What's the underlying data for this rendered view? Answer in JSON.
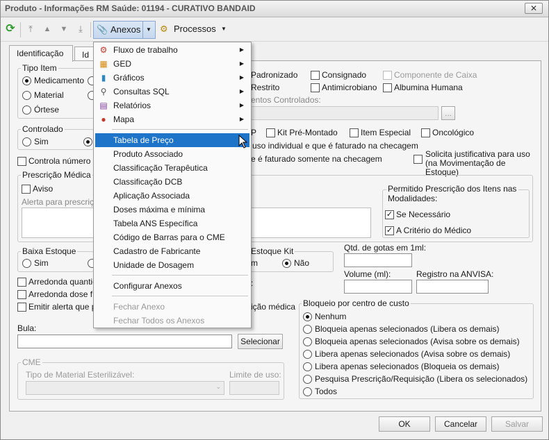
{
  "window": {
    "title": "Produto - Informações RM Saúde: 01194 - CURATIVO BANDAID",
    "close_label": "✕"
  },
  "toolbar": {
    "anexos_label": "Anexos",
    "processos_label": "Processos",
    "dropdown_glyph": "▼"
  },
  "tabs": [
    {
      "label": "Identificação"
    },
    {
      "label": "Id"
    }
  ],
  "tipo_item": {
    "label": "Tipo Item",
    "options": [
      "Medicamento",
      "Material",
      "Órtese"
    ],
    "selected": "Medicamento",
    "checks": [
      {
        "label": "Padronizado",
        "checked": false
      },
      {
        "label": "Consignado",
        "checked": false
      },
      {
        "label": "Componente de Caixa",
        "checked": false,
        "disabled": true
      },
      {
        "label": "Restrito",
        "checked": false
      },
      {
        "label": "Antimicrobiano",
        "checked": false
      },
      {
        "label": "Albumina Humana",
        "checked": false
      }
    ],
    "controlled_label": "entos Controlados:",
    "browse_label": "..."
  },
  "controlado": {
    "label": "Controlado",
    "option_sim": "Sim",
    "checks": [
      {
        "label": "P",
        "checked": false
      },
      {
        "label": "Kit Pré-Montado",
        "checked": false
      },
      {
        "label": "Item Especial",
        "checked": false
      },
      {
        "label": "Oncológico",
        "checked": false
      }
    ]
  },
  "fragments": {
    "uso_individual": "uso individual e que é faturado na checagem",
    "faturado_checagem": "e é faturado somente na checagem",
    "controla_numero": "Controla número d",
    "solicita_justificativa": "Solicita justificativa para uso (na Movimentação de Estoque)"
  },
  "prescricao": {
    "label": "Prescrição Médica",
    "aviso_label": "Aviso",
    "alerta_label": "Alerta para prescriçã",
    "permitido_label": "Permitido Prescrição dos Itens nas Modalidades:",
    "modalidades": [
      {
        "label": "Se Necessário",
        "checked": true
      },
      {
        "label": "A Critério do Médico",
        "checked": true
      }
    ]
  },
  "baixa_estoque": {
    "label": "Baixa Estoque",
    "option_sim": "Sim"
  },
  "estoque_kit": {
    "label": "Estoque Kit",
    "option_m": "m",
    "option_nao": "Não"
  },
  "gotas": {
    "label": "Qtd. de gotas em 1ml:",
    "value": ""
  },
  "volume": {
    "label": "Volume (ml):",
    "value": ""
  },
  "anvisa": {
    "label": "Registro na ANVISA:",
    "value": ""
  },
  "arredonda": [
    "Arredonda quantic",
    "Arredonda dose fr",
    "Emitir alerta que p"
  ],
  "alerta_medica_fragment": "ição médica",
  "colon_fragment": ":",
  "bloqueio": {
    "label": "Bloqueio por centro de custo",
    "options": [
      "Nenhum",
      "Bloqueia apenas selecionados (Libera os demais)",
      "Bloqueia apenas selecionados (Avisa sobre os demais)",
      "Libera apenas selecionados (Avisa sobre os demais)",
      "Libera apenas selecionados (Bloqueia os demais)",
      "Pesquisa Prescrição/Requisição (Libera os selecionados)",
      "Todos"
    ],
    "selected": "Nenhum"
  },
  "bula": {
    "label": "Bula:",
    "value": "",
    "button_label": "Selecionar"
  },
  "cme": {
    "label": "CME",
    "tipo_label": "Tipo de Material Esterilizável:",
    "limite_label": "Limite de uso:"
  },
  "footer": {
    "ok_label": "OK",
    "cancel_label": "Cancelar",
    "save_label": "Salvar"
  },
  "anexos_menu": {
    "items": [
      {
        "label": "Fluxo de trabalho",
        "icon": "workflow-icon",
        "glyph": "⚙",
        "submenu": true
      },
      {
        "label": "GED",
        "icon": "ged-icon",
        "glyph": "▦",
        "submenu": true
      },
      {
        "label": "Gráficos",
        "icon": "chart-icon",
        "glyph": "▮",
        "submenu": true
      },
      {
        "label": "Consultas SQL",
        "icon": "sql-icon",
        "glyph": "⚲",
        "submenu": true
      },
      {
        "label": "Relatórios",
        "icon": "report-icon",
        "glyph": "▤",
        "submenu": true
      },
      {
        "label": "Mapa",
        "icon": "map-pin-icon",
        "glyph": "●",
        "submenu": true
      },
      {
        "label": "Tabela de Preço",
        "highlighted": true
      },
      {
        "label": "Produto Associado"
      },
      {
        "label": "Classificação Terapêutica"
      },
      {
        "label": "Classificação DCB"
      },
      {
        "label": "Aplicação Associada"
      },
      {
        "label": "Doses máxima e mínima"
      },
      {
        "label": "Tabela ANS Específica"
      },
      {
        "label": "Código de Barras para o CME"
      },
      {
        "label": "Cadastro de Fabricante"
      },
      {
        "label": "Unidade de Dosagem"
      },
      {
        "label": "Configurar Anexos"
      },
      {
        "label": "Fechar Anexo",
        "disabled": true
      },
      {
        "label": "Fechar Todos os Anexos",
        "disabled": true
      }
    ],
    "submenu_arrow": "▶"
  },
  "colors": {
    "highlight": "#1e74c9",
    "window_bg": "#f0f0f0"
  }
}
